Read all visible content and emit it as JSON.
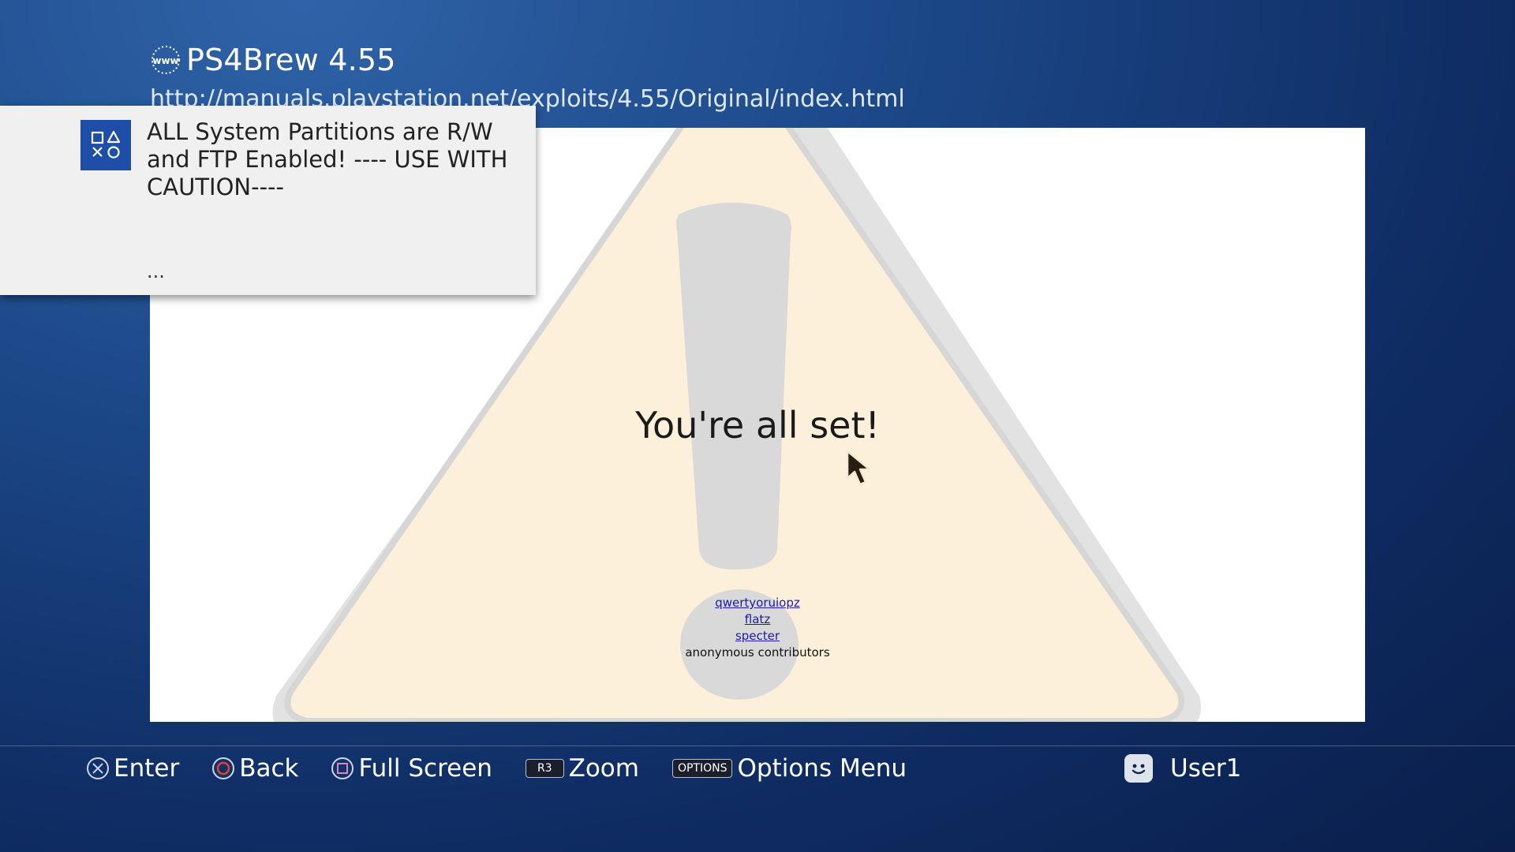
{
  "browser": {
    "title": "PS4Brew 4.55",
    "url": "http://manuals.playstation.net/exploits/4.55/Original/index.html",
    "title_icon": "www-icon"
  },
  "notification": {
    "icon": "playstation-shapes-icon",
    "message": "ALL System Partitions are R/W and FTP Enabled! ---- USE WITH CAUTION----",
    "ellipsis": "..."
  },
  "page": {
    "heading": "You're all set!",
    "credits": {
      "links": [
        "qwertyoruiopz",
        "flatz",
        "specter"
      ],
      "plain": "anonymous contributors"
    },
    "graphic": "warning-triangle-icon"
  },
  "bottom_bar": {
    "hints": [
      {
        "glyph": "cross-button-icon",
        "label": "Enter"
      },
      {
        "glyph": "circle-button-icon",
        "label": "Back"
      },
      {
        "glyph": "square-button-icon",
        "label": "Full Screen"
      },
      {
        "glyph": "R3",
        "label": "Zoom"
      },
      {
        "glyph": "OPTIONS",
        "label": "Options Menu"
      }
    ],
    "user": {
      "name": "User1",
      "avatar": "user-avatar-icon"
    }
  },
  "colors": {
    "background": "#1c4888",
    "notification_icon_bg": "#1f4ea8",
    "link": "#1a1aa6",
    "circle_button": "#e8432a",
    "square_button": "#d887c3",
    "cross_button": "#8ea9de"
  }
}
